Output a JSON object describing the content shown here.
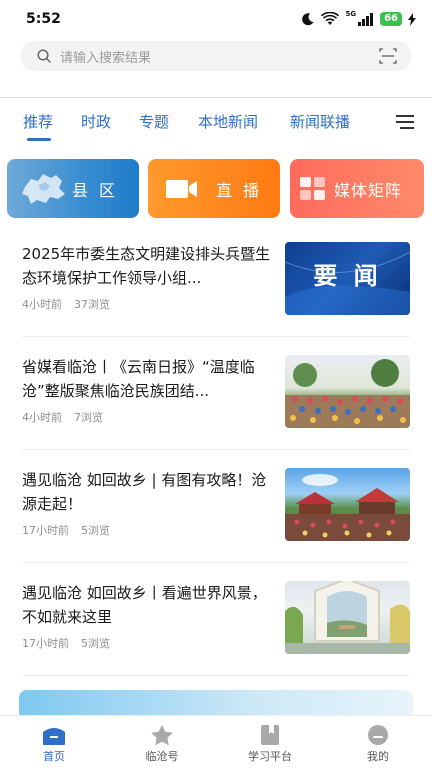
{
  "status": {
    "time": "5:52",
    "battery": "66",
    "network": "5G"
  },
  "search": {
    "placeholder": "请输入搜索结果"
  },
  "tabs": [
    {
      "label": "推荐",
      "active": true
    },
    {
      "label": "时政"
    },
    {
      "label": "专题"
    },
    {
      "label": "本地新闻"
    },
    {
      "label": "新闻联播"
    }
  ],
  "channels": [
    {
      "label": "县 区",
      "icon": "map-icon"
    },
    {
      "label": "直 播",
      "icon": "video-camera-icon"
    },
    {
      "label": "媒体矩阵",
      "icon": "grid-icon"
    }
  ],
  "news": [
    {
      "title": "2025年市委生态文明建设排头兵暨生态环境保护工作领导小组...",
      "time": "4小时前",
      "views": "37浏览",
      "thumb_text": "要 闻"
    },
    {
      "title": "省媒看临沧丨《云南日报》“温度临沧”整版聚焦临沧民族团结...",
      "time": "4小时前",
      "views": "7浏览"
    },
    {
      "title": "遇见临沧 如回故乡 | 有图有攻略！沧源走起！",
      "time": "17小时前",
      "views": "5浏览"
    },
    {
      "title": "遇见临沧 如回故乡丨看遍世界风景，不如就来这里",
      "time": "17小时前",
      "views": "5浏览"
    }
  ],
  "bottom_nav": [
    {
      "label": "首页",
      "active": true,
      "icon": "home-icon"
    },
    {
      "label": "临沧号",
      "icon": "star-icon"
    },
    {
      "label": "学习平台",
      "icon": "book-icon"
    },
    {
      "label": "我的",
      "icon": "profile-icon"
    }
  ],
  "colors": {
    "accent": "#2e6fc7",
    "county": "#3b8fd0",
    "live": "#ff8a1f",
    "media": "#ff7262"
  }
}
